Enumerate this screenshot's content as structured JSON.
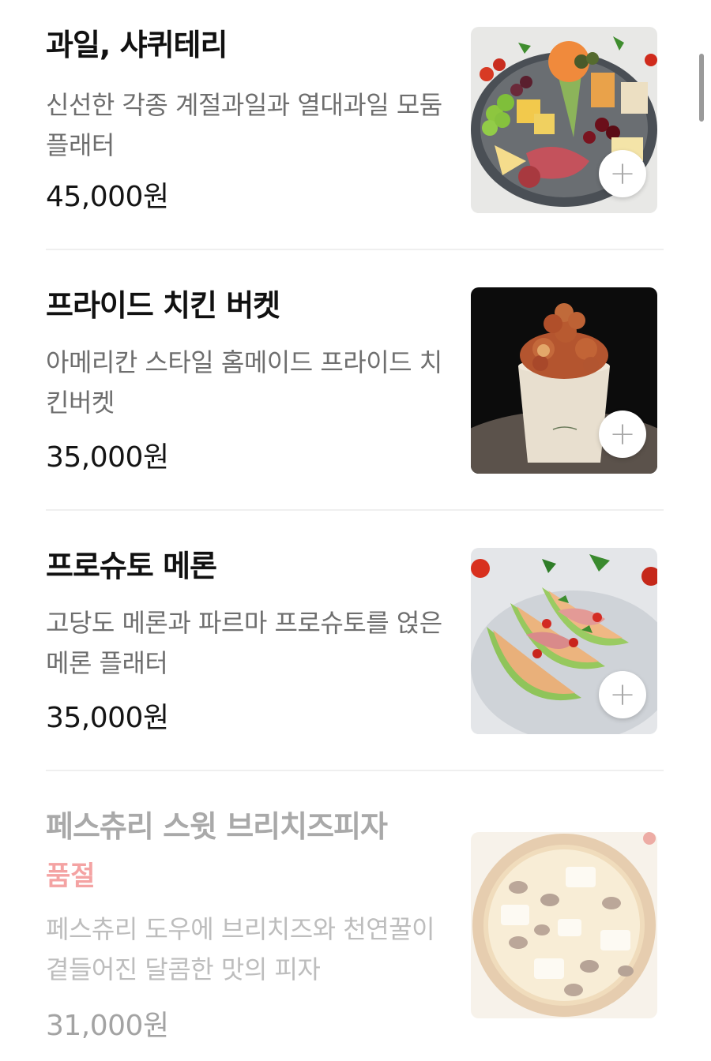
{
  "menu": {
    "items": [
      {
        "title": "과일, 샤퀴테리",
        "description": "신선한 각종 계절과일과 열대과일 모둠 플래터",
        "price": "45,000원",
        "image_icon": "fruit-charcuterie-platter-photo"
      },
      {
        "title": "프라이드 치킨 버켓",
        "description": "아메리칸 스타일 홈메이드 프라이드 치킨버켓",
        "price": "35,000원",
        "image_icon": "fried-chicken-bucket-photo"
      },
      {
        "title": "프로슈토 메론",
        "description": "고당도 메론과 파르마 프로슈토를 얹은 메론 플래터",
        "price": "35,000원",
        "image_icon": "prosciutto-melon-photo"
      },
      {
        "title": "페스츄리 스윗 브리치즈피자",
        "status": "품절",
        "description": "페스츄리 도우에 브리치즈와 천연꿀이 곁들어진 달콤한 맛의 피자",
        "price": "31,000원",
        "image_icon": "brie-pizza-photo"
      }
    ],
    "add_button_icon": "plus-icon"
  },
  "colors": {
    "title": "#111111",
    "description": "#6e6e6e",
    "soldout": "#f4a3a3",
    "divider": "#efefef"
  }
}
